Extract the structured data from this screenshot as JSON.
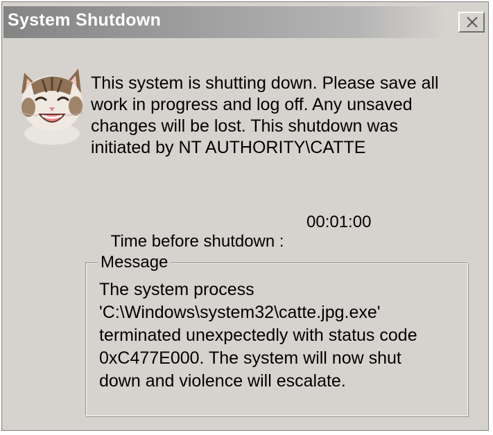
{
  "window": {
    "title": "System Shutdown"
  },
  "icons": {
    "close": "close-icon",
    "avatar": "cat-icon"
  },
  "message": {
    "line1": "This system is shutting down. Please save all",
    "line2": "work in progress and log off. Any unsaved",
    "line3": "changes will be lost. This shutdown was",
    "line4": "initiated by NT AUTHORITY\\CATTE"
  },
  "timer": {
    "label": "Time before shutdown :",
    "value": "00:01:00"
  },
  "group": {
    "legend": "Message",
    "line1": "The system process",
    "line2": "'C:\\Windows\\system32\\catte.jpg.exe'",
    "line3": "terminated unexpectedly with status code",
    "line4": "0xC477E000. The system will now shut",
    "line5": "down and violence will escalate."
  }
}
